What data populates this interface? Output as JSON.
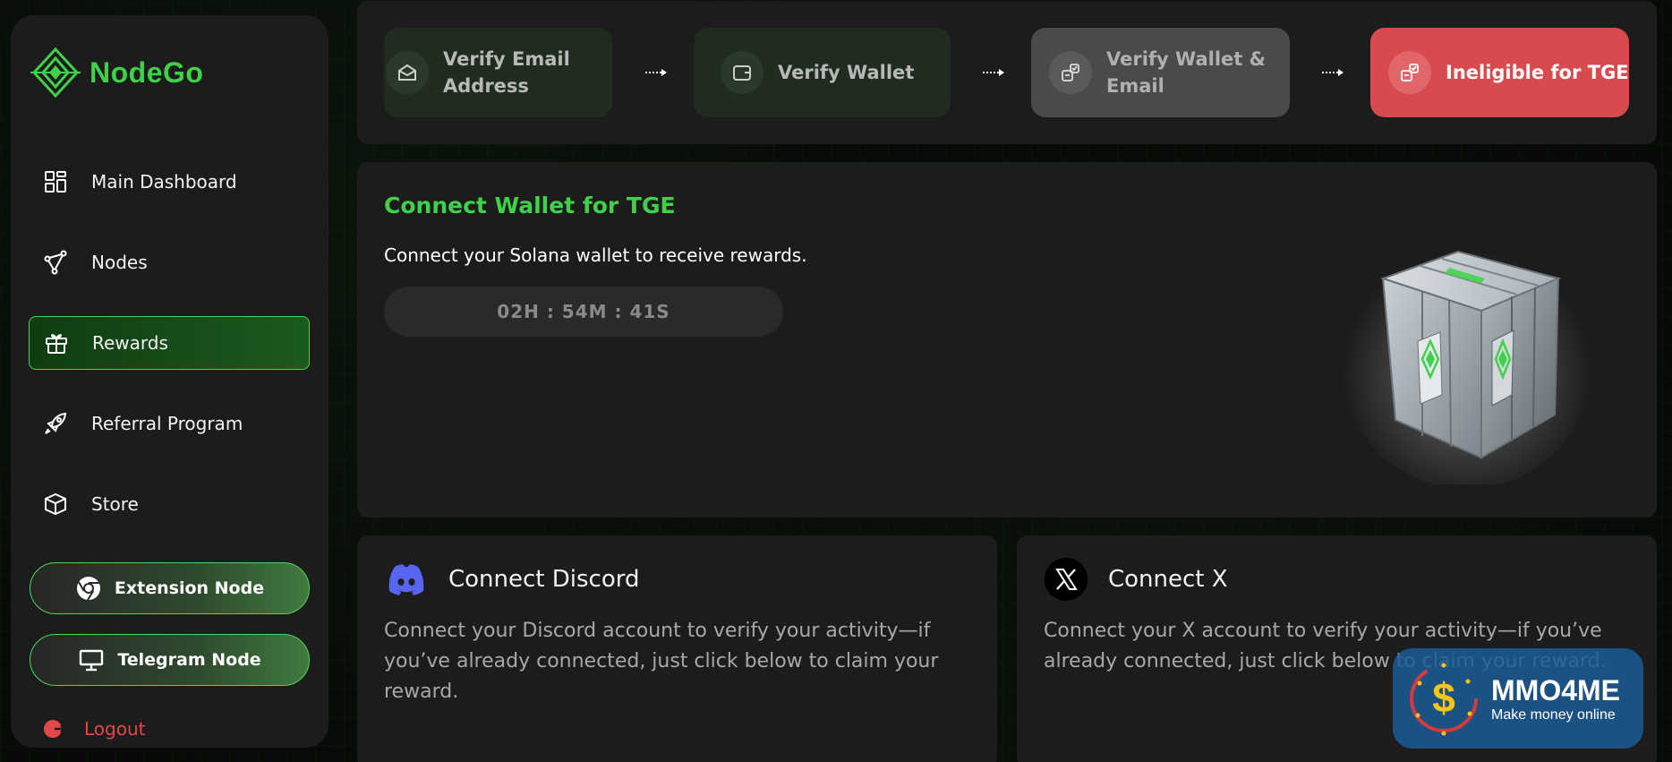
{
  "brand": {
    "name": "NodeGo",
    "accent": "#3fd14a"
  },
  "sidebar": {
    "items": [
      {
        "label": "Main Dashboard",
        "icon": "dashboard-icon",
        "active": false
      },
      {
        "label": "Nodes",
        "icon": "nodes-icon",
        "active": false
      },
      {
        "label": "Rewards",
        "icon": "gift-icon",
        "active": true
      },
      {
        "label": "Referral Program",
        "icon": "rocket-icon",
        "active": false
      },
      {
        "label": "Store",
        "icon": "box-icon",
        "active": false
      }
    ],
    "extension_node_label": "Extension Node",
    "telegram_node_label": "Telegram Node",
    "logout_label": "Logout"
  },
  "steps": [
    {
      "label": "Verify Email Address",
      "icon": "envelope-icon",
      "state": "done"
    },
    {
      "label": "Verify Wallet",
      "icon": "wallet-icon",
      "state": "done"
    },
    {
      "label": "Verify Wallet & Email",
      "icon": "link-check-icon",
      "state": "pending"
    },
    {
      "label": "Ineligible for TGE",
      "icon": "link-check-icon",
      "state": "error"
    }
  ],
  "wallet": {
    "title": "Connect Wallet for TGE",
    "subtitle": "Connect your Solana wallet to receive rewards.",
    "timer": "02H : 54M : 41S"
  },
  "discord": {
    "title": "Connect Discord",
    "description": "Connect your Discord account to verify your activity—if you’ve already connected, just click below to claim your reward."
  },
  "x": {
    "title": "Connect X",
    "description": "Connect your X account to verify your activity—if you’ve already connected, just click below to claim your reward."
  },
  "watermark": {
    "brand": "MMO4ME",
    "tagline": "Make money online"
  },
  "colors": {
    "error": "#d84a4e",
    "panel": "#1c1c1c",
    "discord": "#5865f2"
  }
}
